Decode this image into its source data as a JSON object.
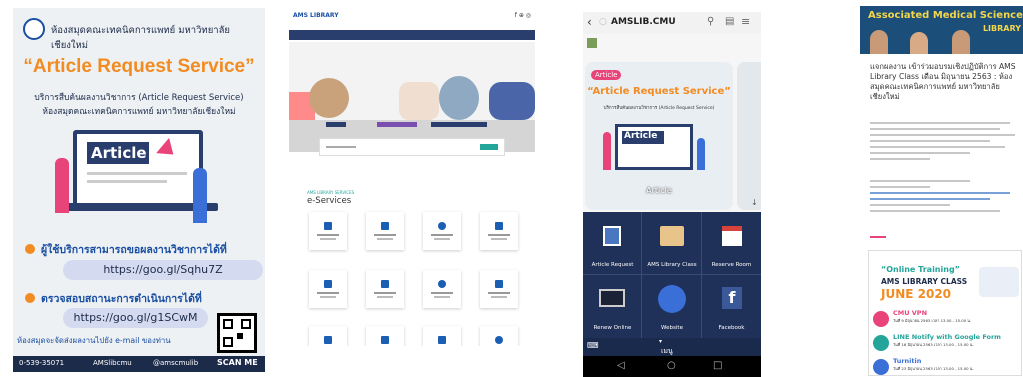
{
  "p1": {
    "header_thai": "ห้องสมุดคณะเทคนิคการแพทย์ มหาวิทยาลัยเชียงใหม่",
    "title": "“Article Request Service”",
    "sub1": "บริการสืบค้นผลงานวิชาการ (Article Request Service)",
    "sub2": "ห้องสมุดคณะเทคนิคการแพทย์ มหาวิทยาลัยเชียงใหม่",
    "article": "Article",
    "bullet1": "ผู้ใช้บริการสามารถขอผลงานวิชาการได้ที่",
    "url1": "https://goo.gl/Sqhu7Z",
    "bullet2": "ตรวจสอบสถานะการดำเนินการได้ที่",
    "url2": "https://goo.gl/g1SCwM",
    "note": "ห้องสมุดจะจัดส่งผลงานไปยัง e-mail ของท่าน",
    "scan": "SCAN ME",
    "phone": "0-539-35071",
    "fb": "AMSlibcmu",
    "line": "@amscmulib"
  },
  "p2": {
    "logo": "AMS LIBRARY",
    "social": "f ⊕ ◎",
    "heading": "e-Services",
    "small": "AMS LIBRARY SERVICES"
  },
  "p3": {
    "site": "AMSLIB.CMU",
    "card_title": "“Article Request Service”",
    "card_article": "Article",
    "tag": "Article",
    "card_sub": "บริการสืบค้นผลงานวิชาการ (Article Request Service)",
    "tiles": [
      {
        "label": "Article Request"
      },
      {
        "label": "AMS Library Class"
      },
      {
        "label": "Reserve Room"
      },
      {
        "label": "Renew Online"
      },
      {
        "label": "Website"
      },
      {
        "label": "Facebook"
      }
    ],
    "menu": "เมนู"
  },
  "p4": {
    "banner": "Associated Medical Sciences",
    "banner2": "LIBRARY",
    "title": "แจกผลงาน เข้าร่วมอบรมเชิงปฏิบัติการ AMS Library Class เดือน มิถุนายน 2563 : ห้องสมุดคณะเทคนิคการแพทย์ มหาวิทยาลัยเชียงใหม่",
    "promo_top": "“Online Training”",
    "promo_mid": "AMS LIBRARY CLASS",
    "promo_month": "JUNE 2020",
    "items": [
      {
        "name": "CMU VPN",
        "date": "วันที่ 9 มิถุนายน 2563 เวลา 13.00 - 15.00 น."
      },
      {
        "name": "LINE Notify with Google Form",
        "date": "วันที่ 16 มิถุนายน 2563 เวลา 13.00 - 15.00 น."
      },
      {
        "name": "Turnitin",
        "date": "วันที่ 23 มิถุนายน 2563 เวลา 13.00 - 15.00 น."
      }
    ]
  },
  "colors": {
    "blue": "#1a4fa3",
    "orange": "#f28b21",
    "dark": "#1c2b4a",
    "pink": "#e8447a"
  }
}
